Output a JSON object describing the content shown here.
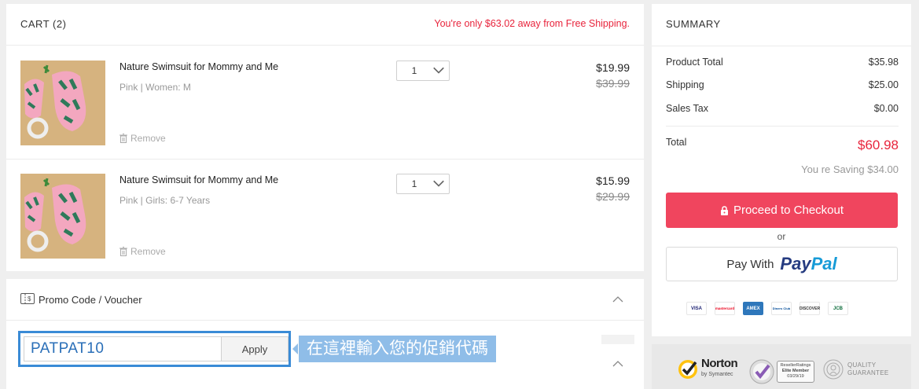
{
  "cart": {
    "title": "CART (2)",
    "shipping_message": "You're only $63.02 away from Free Shipping.",
    "items": [
      {
        "name": "Nature Swimsuit for Mommy and Me",
        "variant": "Pink | Women: M",
        "qty": "1",
        "price": "$19.99",
        "old_price": "$39.99",
        "remove_label": "Remove"
      },
      {
        "name": "Nature Swimsuit for Mommy and Me",
        "variant": "Pink | Girls: 6-7 Years",
        "qty": "1",
        "price": "$15.99",
        "old_price": "$29.99",
        "remove_label": "Remove"
      }
    ]
  },
  "promo": {
    "title": "Promo Code / Voucher",
    "code_value": "PATPAT10",
    "apply_label": "Apply",
    "annotation": "在這裡輸入您的促銷代碼"
  },
  "summary": {
    "title": "SUMMARY",
    "rows": [
      {
        "label": "Product Total",
        "value": "$35.98"
      },
      {
        "label": "Shipping",
        "value": "$25.00"
      },
      {
        "label": "Sales Tax",
        "value": "$0.00"
      }
    ],
    "total_label": "Total",
    "total_value": "$60.98",
    "saving": "You re Saving $34.00",
    "checkout_label": "Proceed to Checkout",
    "or_label": "or",
    "paypal_prefix": "Pay With",
    "paypal_logo_a": "Pay",
    "paypal_logo_b": "Pal",
    "payment_cards": [
      "VISA",
      "mastercard",
      "AMEX",
      "Diners Club",
      "DISCOVER",
      "JCB"
    ]
  },
  "trust": {
    "norton": "Norton",
    "norton_sub": "by Symantec",
    "elite_line1": "ResellerRatings",
    "elite_line2": "Elite Member",
    "elite_line3": "03/29/19",
    "quality_line1": "QUALITY",
    "quality_line2": "GUARANTEE"
  },
  "colors": {
    "accent": "#f0455e",
    "price_red": "#e8243c",
    "annotation": "#8fbde8",
    "highlight_border": "#3a8bd6"
  }
}
